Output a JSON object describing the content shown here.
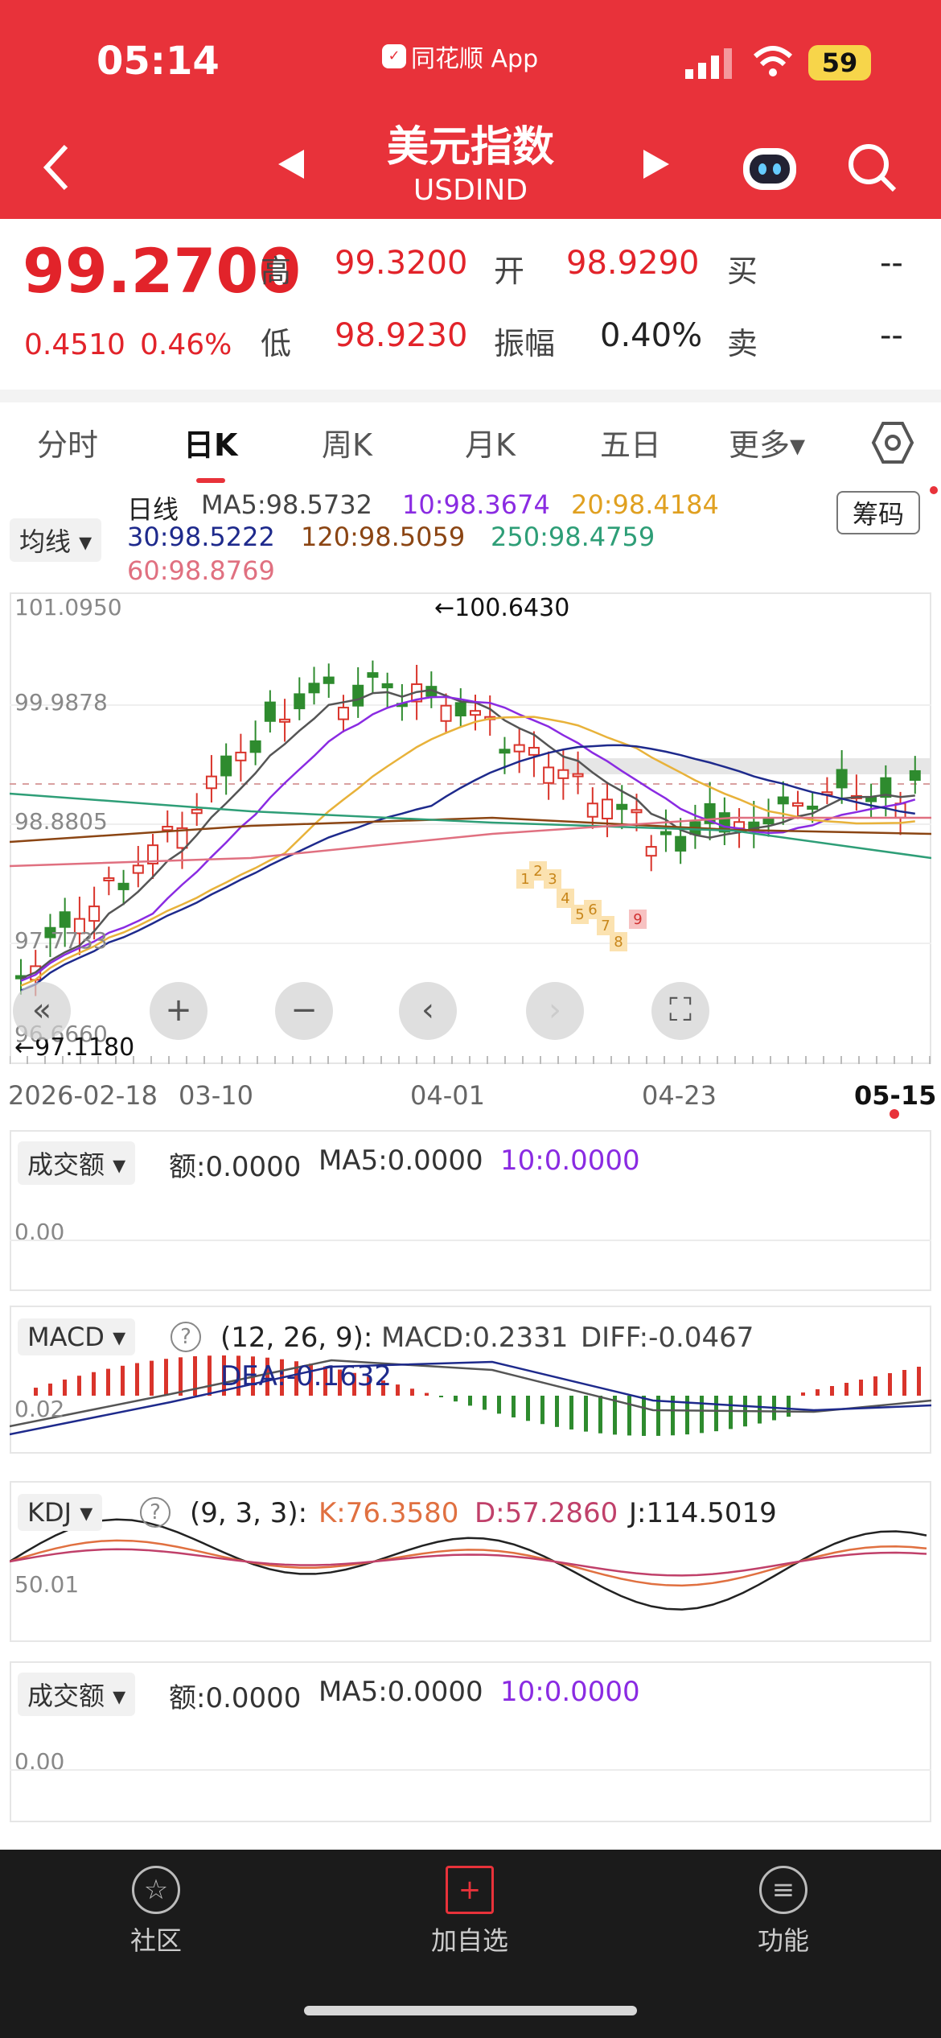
{
  "status_bar": {
    "time": "05:14",
    "source_app": "同花顺 App",
    "battery": "59"
  },
  "header": {
    "title": "美元指数",
    "subtitle": "USDIND"
  },
  "quote": {
    "price": "99.2700",
    "change": "0.4510",
    "change_pct": "0.46%",
    "high_label": "高",
    "high": "99.3200",
    "open_label": "开",
    "open": "98.9290",
    "buy_label": "买",
    "buy": "--",
    "low_label": "低",
    "low": "98.9230",
    "amp_label": "振幅",
    "amp": "0.40%",
    "sell_label": "卖",
    "sell": "--"
  },
  "tabs": [
    "分时",
    "日K",
    "周K",
    "月K",
    "五日",
    "更多▾"
  ],
  "ma_legend": {
    "selector": "均线 ▾",
    "period": "日线",
    "ma5": "MA5:98.5732",
    "ma10": "10:98.3674",
    "ma20": "20:98.4184",
    "ma30": "30:98.5222",
    "ma120": "120:98.5059",
    "ma250": "250:98.4759",
    "ma60": "60:98.8769",
    "chips_button": "筹码"
  },
  "price_chart": {
    "y_labels": [
      "101.0950",
      "99.9878",
      "98.8805",
      "97.7733",
      "96.6660"
    ],
    "high_marker": "←100.6430",
    "low_marker": "←97.1180",
    "dates": [
      "2026-02-18",
      "03-10",
      "04-01",
      "04-23",
      "05-15"
    ],
    "count_labels": [
      "1",
      "2",
      "3",
      "4",
      "5",
      "6",
      "7",
      "8",
      "9"
    ]
  },
  "volume_panel_1": {
    "selector": "成交额 ▾",
    "amount": "额:0.0000",
    "ma5": "MA5:0.0000",
    "ma10": "10:0.0000",
    "zero": "0.00"
  },
  "macd_panel": {
    "selector": "MACD ▾",
    "help": "?",
    "params": "(12, 26, 9):",
    "macd": "MACD:0.2331",
    "diff": "DIFF:-0.0467",
    "dea": "DEA:-0.1632",
    "axis": "0.02"
  },
  "kdj_panel": {
    "selector": "KDJ ▾",
    "help": "?",
    "params": "(9, 3, 3):",
    "k": "K:76.3580",
    "d": "D:57.2860",
    "j": "J:114.5019",
    "axis": "50.01"
  },
  "volume_panel_2": {
    "selector": "成交额 ▾",
    "amount": "额:0.0000",
    "ma5": "MA5:0.0000",
    "ma10": "10:0.0000",
    "zero": "0.00"
  },
  "bottom_nav": {
    "community": "社区",
    "add_watchlist": "加自选",
    "functions": "功能"
  },
  "colors": {
    "brand": "#e8323a",
    "up": "#d9342b",
    "down": "#2e8b2e",
    "ma5": "#555555",
    "ma10": "#8a2be2",
    "ma20": "#e8b23a",
    "ma30": "#1e2a8c",
    "ma120": "#8b4513",
    "ma250": "#2e9e77",
    "ma60": "#e07080"
  }
}
